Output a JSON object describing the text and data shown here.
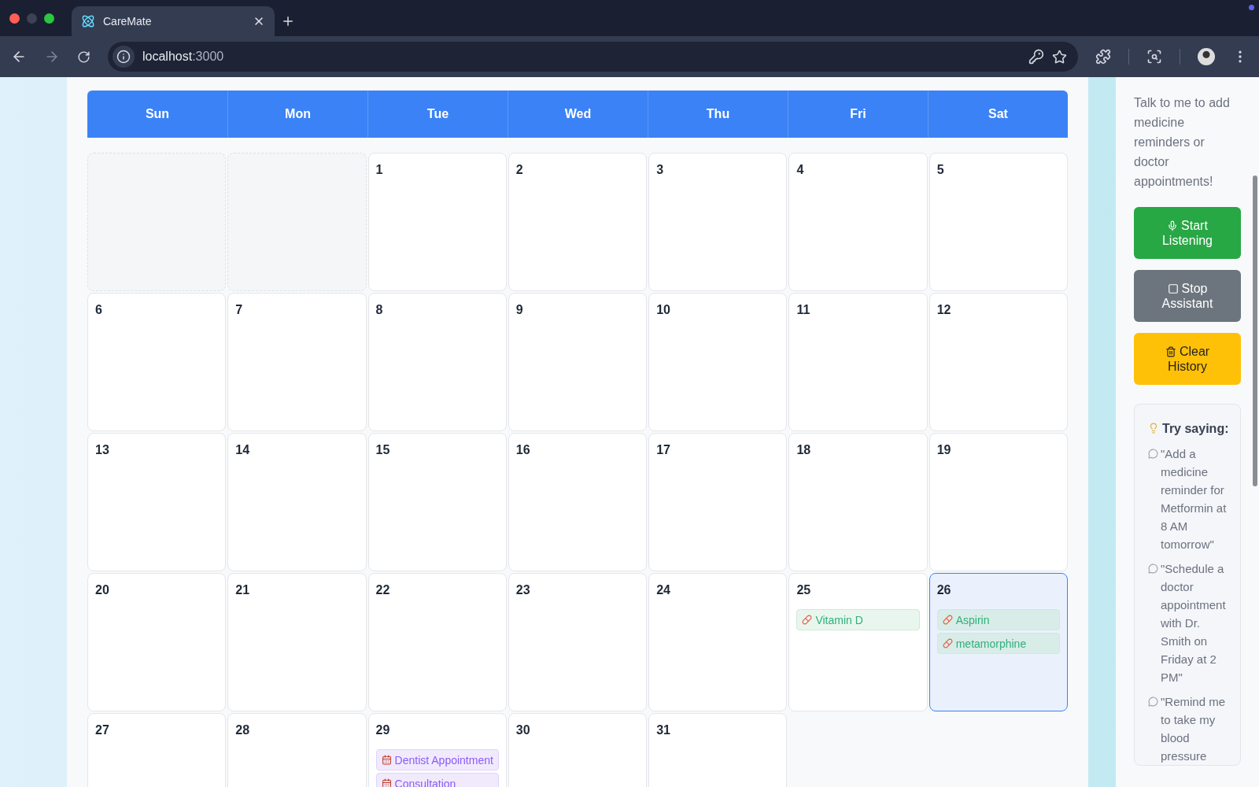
{
  "browser": {
    "tab_title": "CareMate",
    "url_host": "localhost",
    "url_port": ":3000"
  },
  "calendar": {
    "weekdays": [
      "Sun",
      "Mon",
      "Tue",
      "Wed",
      "Thu",
      "Fri",
      "Sat"
    ],
    "weeks": [
      [
        {
          "kind": "blank"
        },
        {
          "kind": "blank"
        },
        {
          "kind": "day",
          "day": "1",
          "selected": false
        },
        {
          "kind": "day",
          "day": "2",
          "selected": false
        },
        {
          "kind": "day",
          "day": "3",
          "selected": false
        },
        {
          "kind": "day",
          "day": "4",
          "selected": false
        },
        {
          "kind": "day",
          "day": "5",
          "selected": false
        }
      ],
      [
        {
          "kind": "day",
          "day": "6",
          "selected": false
        },
        {
          "kind": "day",
          "day": "7",
          "selected": false
        },
        {
          "kind": "day",
          "day": "8",
          "selected": false
        },
        {
          "kind": "day",
          "day": "9",
          "selected": false
        },
        {
          "kind": "day",
          "day": "10",
          "selected": false
        },
        {
          "kind": "day",
          "day": "11",
          "selected": false
        },
        {
          "kind": "day",
          "day": "12",
          "selected": false
        }
      ],
      [
        {
          "kind": "day",
          "day": "13",
          "selected": false
        },
        {
          "kind": "day",
          "day": "14",
          "selected": false
        },
        {
          "kind": "day",
          "day": "15",
          "selected": false
        },
        {
          "kind": "day",
          "day": "16",
          "selected": false
        },
        {
          "kind": "day",
          "day": "17",
          "selected": false
        },
        {
          "kind": "day",
          "day": "18",
          "selected": false
        },
        {
          "kind": "day",
          "day": "19",
          "selected": false
        }
      ],
      [
        {
          "kind": "day",
          "day": "20",
          "selected": false
        },
        {
          "kind": "day",
          "day": "21",
          "selected": false
        },
        {
          "kind": "day",
          "day": "22",
          "selected": false
        },
        {
          "kind": "day",
          "day": "23",
          "selected": false
        },
        {
          "kind": "day",
          "day": "24",
          "selected": false
        },
        {
          "kind": "day",
          "day": "25",
          "selected": false,
          "events": [
            {
              "kind": "medicine",
              "label": "Vitamin D"
            }
          ]
        },
        {
          "kind": "day",
          "day": "26",
          "selected": true,
          "events": [
            {
              "kind": "medicine",
              "label": "Aspirin"
            },
            {
              "kind": "medicine",
              "label": "metamorphine"
            }
          ]
        }
      ],
      [
        {
          "kind": "day",
          "day": "27",
          "selected": false
        },
        {
          "kind": "day",
          "day": "28",
          "selected": false
        },
        {
          "kind": "day",
          "day": "29",
          "selected": false,
          "events": [
            {
              "kind": "appointment",
              "label": "Dentist Appointment"
            },
            {
              "kind": "appointment",
              "label": "Consultation"
            }
          ]
        },
        {
          "kind": "day",
          "day": "30",
          "selected": false
        },
        {
          "kind": "day",
          "day": "31",
          "selected": false
        }
      ]
    ]
  },
  "assistant": {
    "intro": "Talk to me to add medicine reminders or doctor appointments!",
    "buttons": [
      {
        "kind": "start",
        "label": "Start Listening"
      },
      {
        "kind": "stop",
        "label": "Stop Assistant"
      },
      {
        "kind": "clear",
        "label": "Clear History"
      }
    ],
    "tips": {
      "title": "Try saying:",
      "items": [
        "\"Add a medicine reminder for Metformin at 8 AM tomorrow\"",
        "\"Schedule a doctor appointment with Dr. Smith on Friday at 2 PM\"",
        "\"Remind me to take my blood pressure"
      ]
    }
  }
}
